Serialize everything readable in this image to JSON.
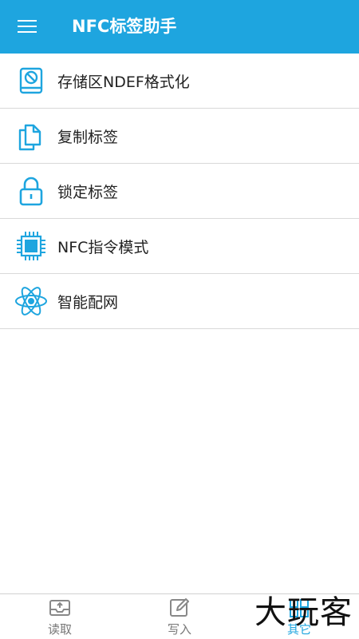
{
  "app_bar": {
    "title": "NFC标签助手",
    "menu_icon": "hamburger-menu-icon",
    "background_color": "#1ea5df"
  },
  "menu": {
    "items": [
      {
        "label": "存储区NDEF格式化",
        "icon": "storage-format-icon"
      },
      {
        "label": "复制标签",
        "icon": "copy-icon"
      },
      {
        "label": "锁定标签",
        "icon": "lock-icon"
      },
      {
        "label": "NFC指令模式",
        "icon": "chip-icon"
      },
      {
        "label": "智能配网",
        "icon": "atom-icon"
      }
    ]
  },
  "bottom_nav": {
    "tabs": [
      {
        "label": "读取",
        "icon": "read-tray-icon",
        "active": false
      },
      {
        "label": "写入",
        "icon": "write-pen-icon",
        "active": false
      },
      {
        "label": "其它",
        "icon": "other-icon",
        "active": true
      }
    ]
  },
  "watermark": {
    "text": "大玩客"
  },
  "colors": {
    "accent": "#1ea5df",
    "text": "#222222",
    "inactive": "#777777",
    "divider": "#d9d9d9"
  }
}
